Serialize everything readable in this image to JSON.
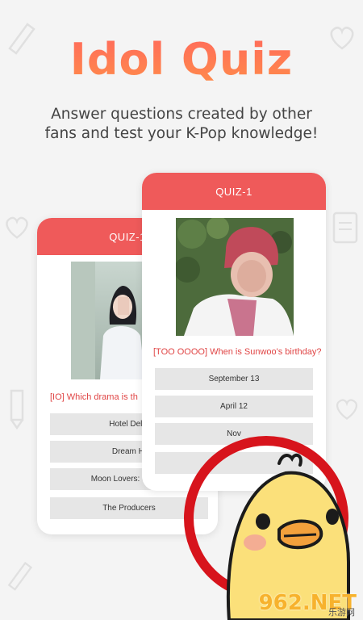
{
  "hero": {
    "title": "Idol Quiz",
    "subtitle_line1": "Answer questions created by other",
    "subtitle_line2": "fans and test your K-Pop knowledge!"
  },
  "card_back": {
    "header": "QUIZ-1",
    "question": "[IO] Which drama is th",
    "answers": [
      "Hotel Del L",
      "Dream Hi",
      "Moon Lovers: Scarlet",
      "The Producers"
    ]
  },
  "card_front": {
    "header": "QUIZ-1",
    "question": "[TOO OOOO] When is Sunwoo's birthday?",
    "answers": [
      "September 13",
      "April 12",
      "Nov",
      ""
    ]
  },
  "watermark": {
    "brand": "962.NET",
    "sub": "乐游网"
  },
  "colors": {
    "accent": "#ef5a5a",
    "title_gradient_top": "#ff6a5c",
    "title_gradient_bottom": "#ff8b4a",
    "question_text": "#e04545"
  }
}
